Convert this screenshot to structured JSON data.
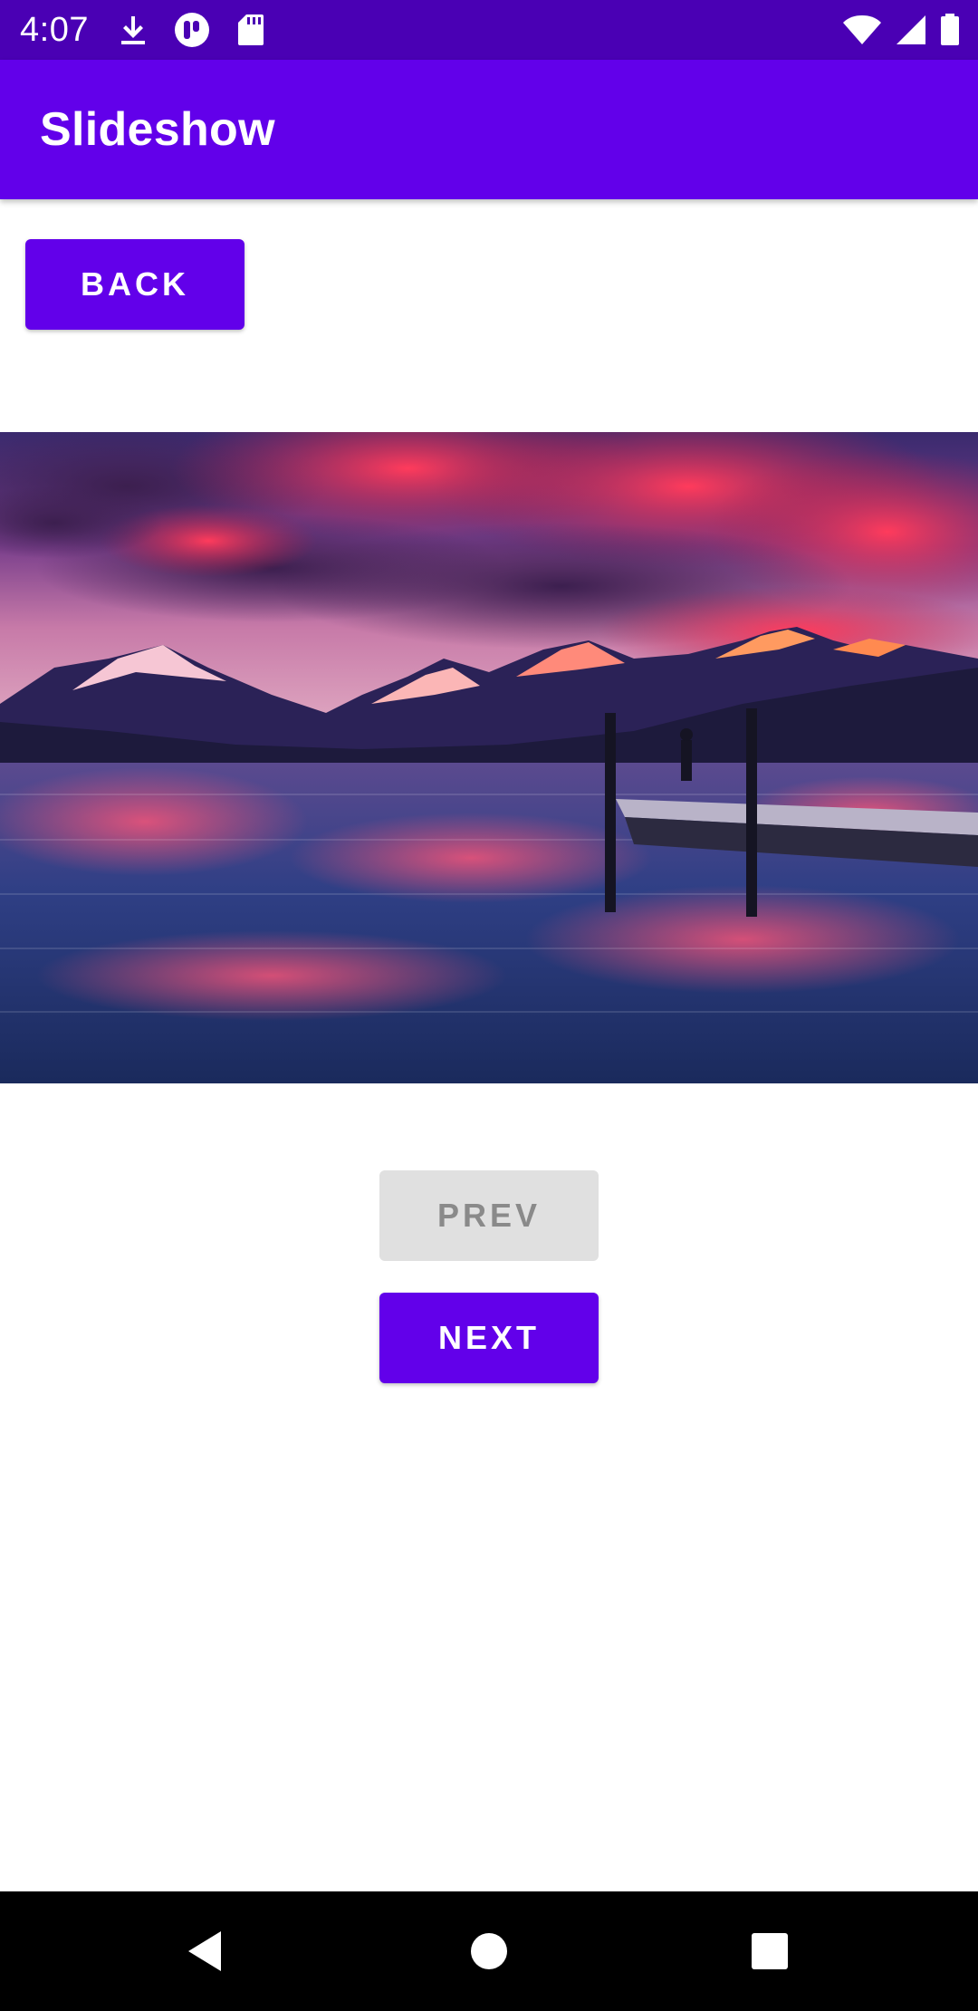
{
  "status_bar": {
    "time": "4:07",
    "left_icons": [
      "download-icon",
      "pocket-icon",
      "sd-card-icon"
    ],
    "right_icons": [
      "wifi-icon",
      "cell-signal-icon",
      "battery-icon"
    ]
  },
  "app_bar": {
    "title": "Slideshow"
  },
  "buttons": {
    "back_label": "BACK",
    "prev_label": "PREV",
    "next_label": "NEXT"
  },
  "slide": {
    "content": "lake-sunset-mountains-photo"
  },
  "nav_bar": {
    "items": [
      "back-icon",
      "home-icon",
      "recents-icon"
    ]
  },
  "colors": {
    "status_bar": "#4a00b4",
    "app_bar": "#6200ea",
    "primary": "#6200ea",
    "disabled_bg": "#e0e0e0",
    "disabled_text": "#8a8a8a"
  }
}
